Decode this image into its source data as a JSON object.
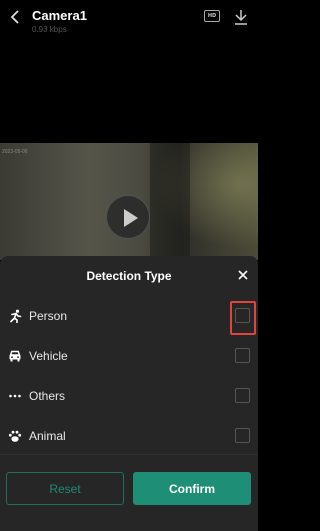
{
  "header": {
    "title": "Camera1",
    "bitrate": "0.93 kbps",
    "hd_badge": "HD"
  },
  "video": {
    "timestamp": "2023-05-06"
  },
  "sheet": {
    "title": "Detection Type",
    "options": [
      {
        "label": "Person",
        "icon": "running-person-icon",
        "checked": false
      },
      {
        "label": "Vehicle",
        "icon": "car-icon",
        "checked": false
      },
      {
        "label": "Others",
        "icon": "ellipsis-icon",
        "checked": false
      },
      {
        "label": "Animal",
        "icon": "paw-icon",
        "checked": false
      }
    ],
    "reset_label": "Reset",
    "confirm_label": "Confirm"
  },
  "colors": {
    "accent": "#1f8e76",
    "highlight": "#e0443d",
    "sheet_bg": "#262626"
  }
}
